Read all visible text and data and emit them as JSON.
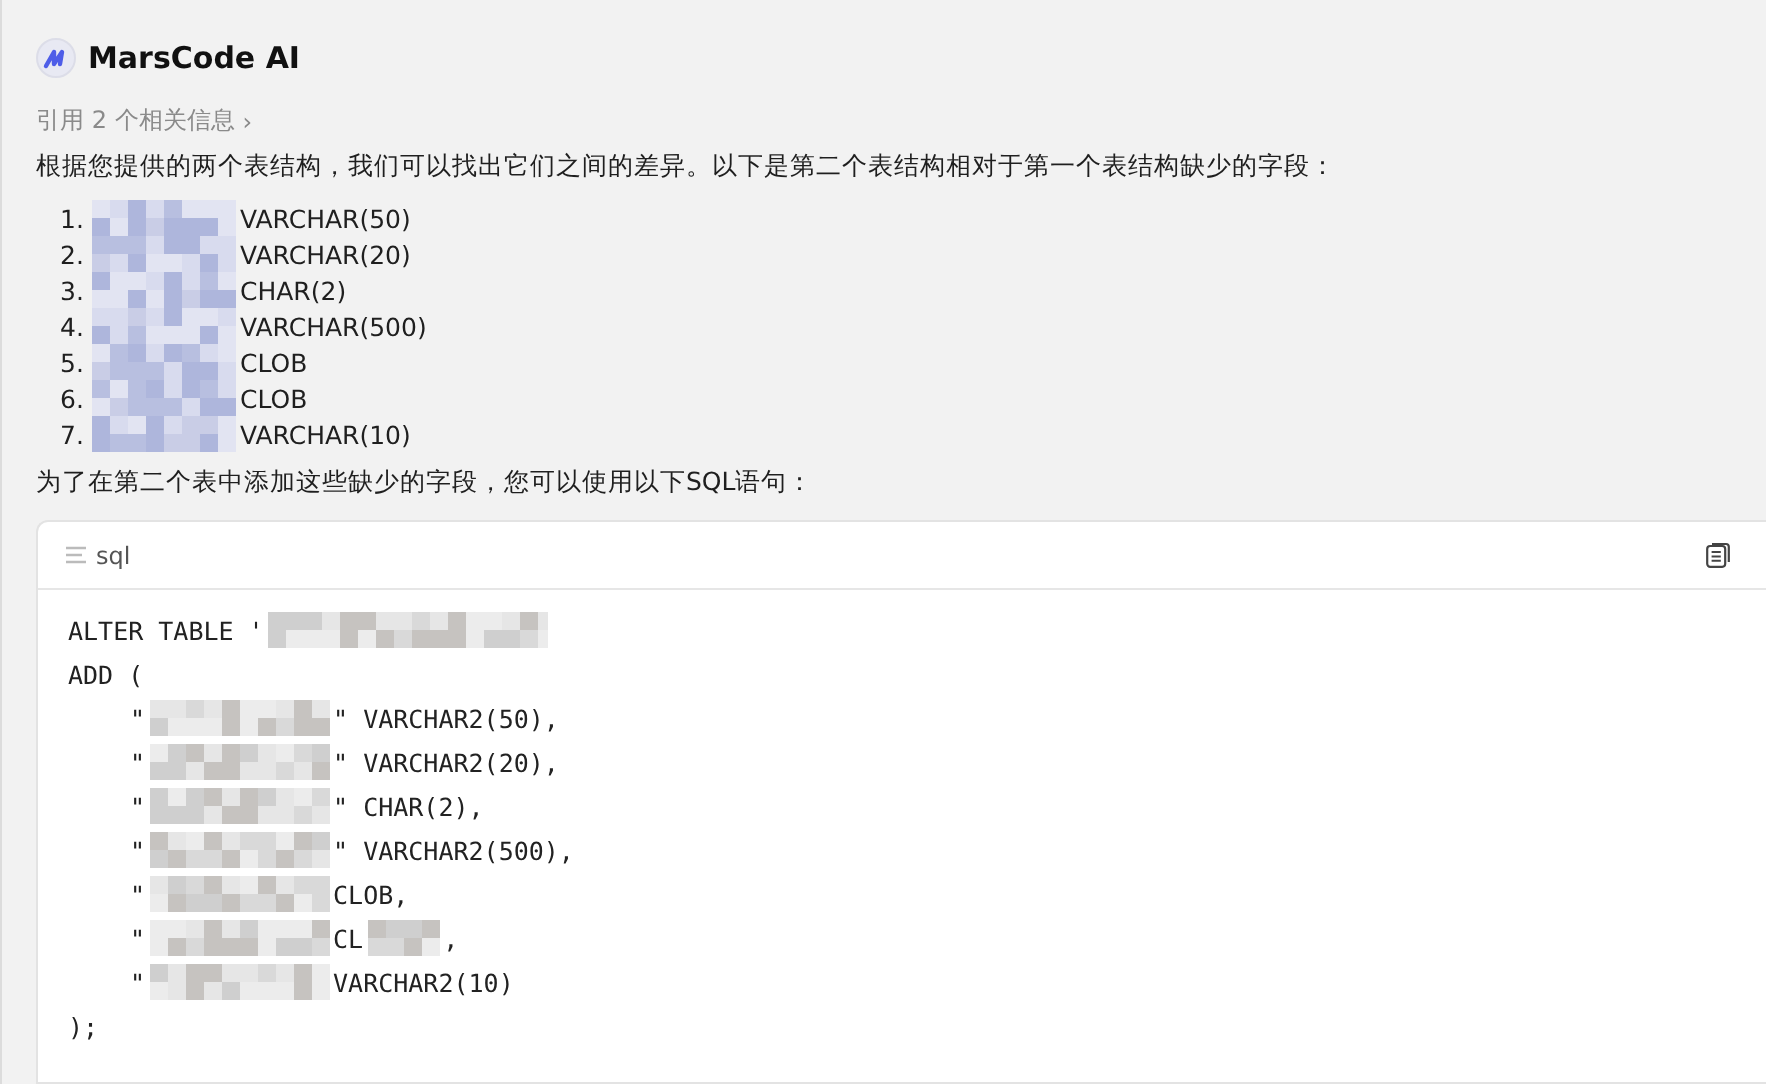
{
  "header": {
    "title": "MarsCode AI"
  },
  "references": {
    "label": "引用 2 个相关信息",
    "chevron": "›"
  },
  "intro": "根据您提供的两个表结构，我们可以找出它们之间的差异。以下是第二个表结构相对于第一个表结构缺少的字段：",
  "missing_fields": [
    {
      "number": "1.",
      "redacted": true,
      "text": "VARCHAR(50)"
    },
    {
      "number": "2.",
      "redacted": true,
      "text": "VARCHAR(20)"
    },
    {
      "number": "3.",
      "redacted": true,
      "text": "CHAR(2)"
    },
    {
      "number": "4.",
      "redacted": true,
      "text": "VARCHAR(500)"
    },
    {
      "number": "5.",
      "redacted": true,
      "text": "CLOB"
    },
    {
      "number": "6.",
      "redacted": true,
      "text": "CLOB"
    },
    {
      "number": "7.",
      "redacted": true,
      "text": "VARCHAR(10)"
    }
  ],
  "outro": "为了在第二个表中添加这些缺少的字段，您可以使用以下SQL语句：",
  "code_block": {
    "language": "sql",
    "lines": [
      {
        "indented": false,
        "segments": [
          {
            "kind": "text",
            "text": "ALTER TABLE '"
          },
          {
            "kind": "redacted"
          }
        ]
      },
      {
        "indented": false,
        "segments": [
          {
            "kind": "text",
            "text": "ADD ("
          }
        ]
      },
      {
        "indented": true,
        "segments": [
          {
            "kind": "text",
            "text": "\""
          },
          {
            "kind": "redacted"
          },
          {
            "kind": "text",
            "text": "\" VARCHAR2(50),"
          }
        ]
      },
      {
        "indented": true,
        "segments": [
          {
            "kind": "text",
            "text": "\""
          },
          {
            "kind": "redacted"
          },
          {
            "kind": "text",
            "text": "\" VARCHAR2(20),"
          }
        ]
      },
      {
        "indented": true,
        "segments": [
          {
            "kind": "text",
            "text": "\""
          },
          {
            "kind": "redacted"
          },
          {
            "kind": "text",
            "text": "\" CHAR(2),"
          }
        ]
      },
      {
        "indented": true,
        "segments": [
          {
            "kind": "text",
            "text": "\""
          },
          {
            "kind": "redacted"
          },
          {
            "kind": "text",
            "text": "\" VARCHAR2(500),"
          }
        ]
      },
      {
        "indented": true,
        "segments": [
          {
            "kind": "text",
            "text": "\""
          },
          {
            "kind": "redacted"
          },
          {
            "kind": "text",
            "text": "CLOB,"
          }
        ]
      },
      {
        "indented": true,
        "segments": [
          {
            "kind": "text",
            "text": "\""
          },
          {
            "kind": "redacted"
          },
          {
            "kind": "text",
            "text": "CL"
          },
          {
            "kind": "redacted"
          },
          {
            "kind": "text",
            "text": ","
          }
        ]
      },
      {
        "indented": true,
        "segments": [
          {
            "kind": "text",
            "text": "\""
          },
          {
            "kind": "redacted"
          },
          {
            "kind": "text",
            "text": "VARCHAR2(10)"
          }
        ]
      },
      {
        "indented": false,
        "segments": [
          {
            "kind": "text",
            "text": ");"
          }
        ]
      }
    ]
  }
}
